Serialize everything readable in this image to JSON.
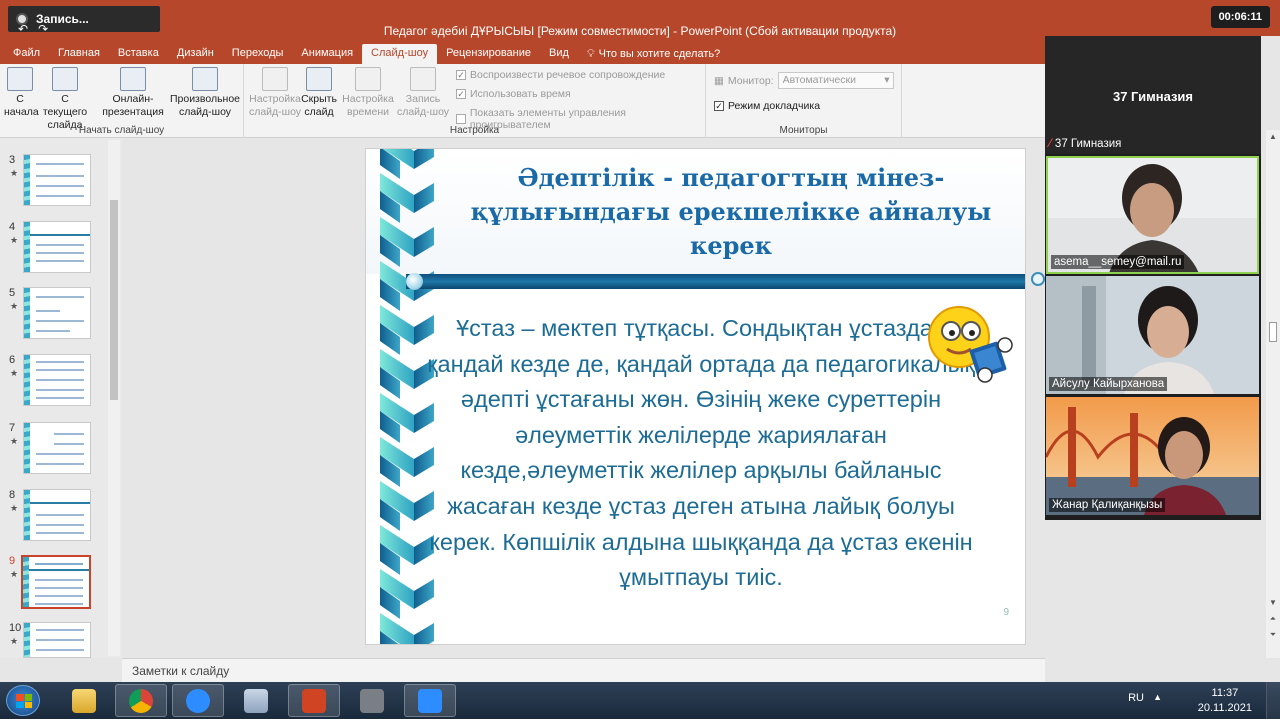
{
  "recorder": {
    "label": "Запись..."
  },
  "window": {
    "title": "Педагог әдебиі ДҰРЫСЫЫ [Режим совместимости] - PowerPoint (Сбой активации продукта)"
  },
  "timer": "00:06:11",
  "tabs": [
    "Файл",
    "Главная",
    "Вставка",
    "Дизайн",
    "Переходы",
    "Анимация",
    "Слайд-шоу",
    "Рецензирование",
    "Вид"
  ],
  "active_tab": "Слайд-шоу",
  "tell_me": "Что вы хотите сделать?",
  "ribbon": {
    "start": {
      "label": "Начать слайд-шоу",
      "from_start": "С начала",
      "from_current": "С текущего слайда",
      "online": "Онлайн-презентация",
      "custom": "Произвольное слайд-шоу"
    },
    "setup": {
      "label": "Настройка",
      "setup_show": "Настройка слайд-шоу",
      "hide_slide": "Скрыть слайд",
      "rehearse": "Настройка времени",
      "record": "Запись слайд-шоу",
      "play_narration": "Воспроизвести речевое сопровождение",
      "use_timings": "Использовать время",
      "show_controls": "Показать элементы управления проигрывателем"
    },
    "monitors": {
      "label": "Мониторы",
      "monitor_label": "Монитор:",
      "monitor_value": "Автоматически",
      "presenter_view": "Режим докладчика"
    }
  },
  "thumbnails": [
    {
      "num": "3"
    },
    {
      "num": "4"
    },
    {
      "num": "5"
    },
    {
      "num": "6"
    },
    {
      "num": "7"
    },
    {
      "num": "8"
    },
    {
      "num": "9"
    },
    {
      "num": "10"
    }
  ],
  "slide": {
    "title": "Әдептілік - педагогтың мінез-құлығындағы ерекшелікке айналуы керек",
    "body": "Ұстаз – мектеп тұтқасы. Сондықтан  ұстаздар қандай кезде де, қандай ортада да педагогикалық әдепті ұстағаны жөн. Өзінің жеке суреттерін әлеуметтік желілерде жариялаған кезде,әлеуметтік желілер арқылы байланыс жасаған кезде ұстаз деген атына лайық болуы керек. Көпшілік алдына шыққанда да ұстаз екенін ұмытпауы тиіс.",
    "number": "9"
  },
  "notes": "Заметки к слайду",
  "zoom": {
    "host_name": "37 Гимназия",
    "host_label": "37 Гимназия",
    "participants": [
      "asema__semey@mail.ru",
      "Айсулу Кайырханова",
      "Жанар Қалиқанқызы"
    ]
  },
  "tray": {
    "lang": "RU",
    "time": "11:37",
    "date": "20.11.2021"
  },
  "colors": {
    "accent": "#b7472a",
    "slide_text": "#1d6c95",
    "slide_title": "#1b6aa8"
  }
}
